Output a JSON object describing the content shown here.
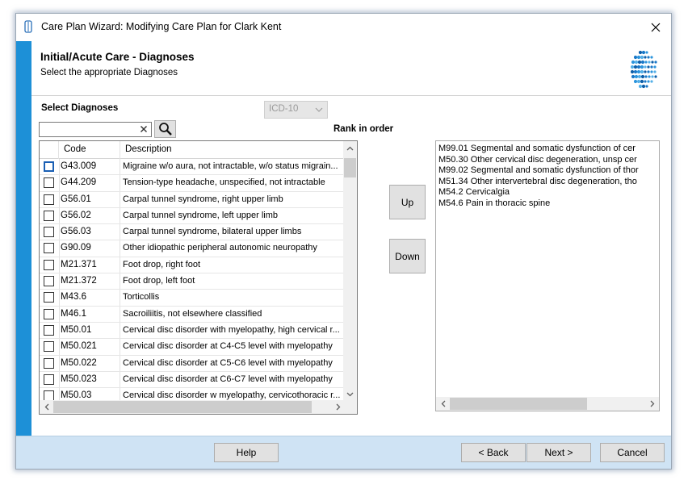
{
  "window": {
    "title": "Care Plan Wizard:  Modifying Care Plan for Clark Kent"
  },
  "header": {
    "title": "Initial/Acute Care - Diagnoses",
    "subtitle": "Select the appropriate Diagnoses"
  },
  "filter": {
    "section_label": "Select Diagnoses",
    "code_system": "ICD-10",
    "search_value": "",
    "search_placeholder": ""
  },
  "grid": {
    "columns": [
      "Code",
      "Description"
    ],
    "rows": [
      {
        "code": "G43.009",
        "description": "Migraine w/o aura, not intractable, w/o status migrain...",
        "checked": false
      },
      {
        "code": "G44.209",
        "description": "Tension-type headache, unspecified, not intractable",
        "checked": false
      },
      {
        "code": "G56.01",
        "description": "Carpal tunnel syndrome, right upper limb",
        "checked": false
      },
      {
        "code": "G56.02",
        "description": "Carpal tunnel syndrome, left upper limb",
        "checked": false
      },
      {
        "code": "G56.03",
        "description": "Carpal tunnel syndrome, bilateral upper limbs",
        "checked": false
      },
      {
        "code": "G90.09",
        "description": "Other idiopathic peripheral autonomic neuropathy",
        "checked": false
      },
      {
        "code": "M21.371",
        "description": "Foot drop, right foot",
        "checked": false
      },
      {
        "code": "M21.372",
        "description": "Foot drop, left foot",
        "checked": false
      },
      {
        "code": "M43.6",
        "description": "Torticollis",
        "checked": false
      },
      {
        "code": "M46.1",
        "description": "Sacroiliitis, not elsewhere classified",
        "checked": false
      },
      {
        "code": "M50.01",
        "description": "Cervical disc disorder with myelopathy, high cervical r...",
        "checked": false
      },
      {
        "code": "M50.021",
        "description": "Cervical disc disorder at C4-C5 level with myelopathy",
        "checked": false
      },
      {
        "code": "M50.022",
        "description": "Cervical disc disorder at C5-C6 level with myelopathy",
        "checked": false
      },
      {
        "code": "M50.023",
        "description": "Cervical disc disorder at C6-C7 level with myelopathy",
        "checked": false
      },
      {
        "code": "M50.03",
        "description": "Cervical disc disorder w myelopathy, cervicothoracic r...",
        "checked": false
      }
    ]
  },
  "rank": {
    "label": "Rank in order",
    "up_label": "Up",
    "down_label": "Down",
    "items": [
      "M99.01 Segmental and somatic dysfunction of cer",
      "M50.30 Other cervical disc degeneration, unsp cer",
      "M99.02 Segmental and somatic dysfunction of thor",
      "M51.34 Other intervertebral disc degeneration, tho",
      "M54.2 Cervicalgia",
      "M54.6 Pain in thoracic spine"
    ]
  },
  "footer": {
    "help_label": "Help",
    "back_label": "< Back",
    "next_label": "Next >",
    "cancel_label": "Cancel"
  },
  "colors": {
    "accent_stripe": "#1d90d7",
    "footer_bg": "#cfe3f4",
    "button_bg": "#e1e1e1"
  },
  "icons": [
    "app-icon",
    "close-icon",
    "logo-icon",
    "chevron-down-icon",
    "clear-icon",
    "search-icon",
    "scroll-up-icon",
    "scroll-down-icon",
    "scroll-left-icon",
    "scroll-right-icon"
  ]
}
